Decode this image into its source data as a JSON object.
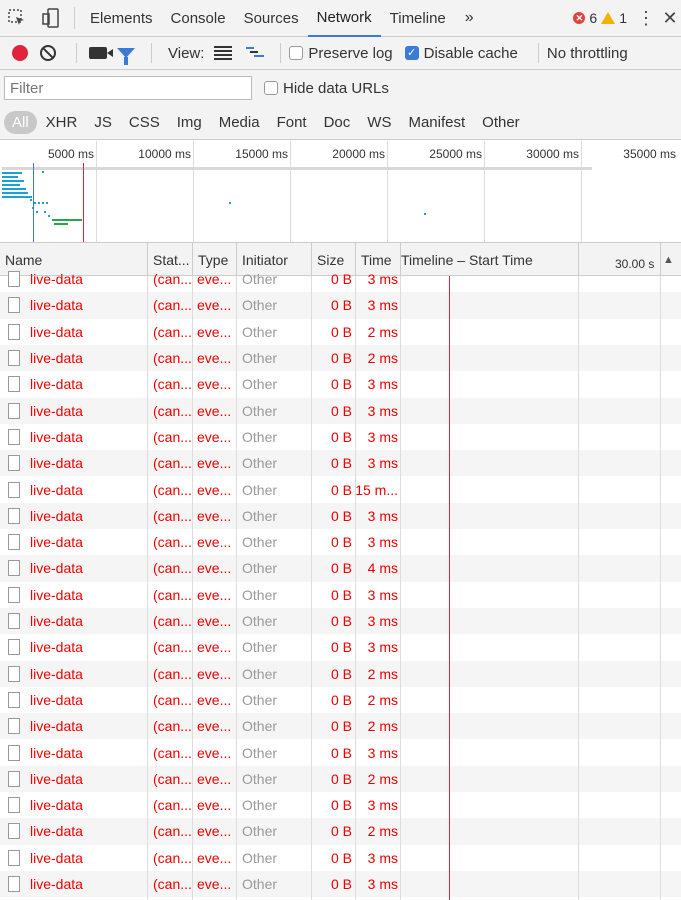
{
  "tabs": [
    "Elements",
    "Console",
    "Sources",
    "Network",
    "Timeline"
  ],
  "active_tab": "Network",
  "more_tabs": "»",
  "error_count": "6",
  "warning_count": "1",
  "toolbar": {
    "view_label": "View:",
    "preserve_log": "Preserve log",
    "disable_cache": "Disable cache",
    "throttling": "No throttling"
  },
  "filter": {
    "placeholder": "Filter",
    "hide_data_urls": "Hide data URLs"
  },
  "types": [
    "All",
    "XHR",
    "JS",
    "CSS",
    "Img",
    "Media",
    "Font",
    "Doc",
    "WS",
    "Manifest",
    "Other"
  ],
  "overview_ticks": [
    "5000 ms",
    "10000 ms",
    "15000 ms",
    "20000 ms",
    "25000 ms",
    "30000 ms",
    "35000 ms"
  ],
  "columns": {
    "name": "Name",
    "status": "Stat...",
    "type": "Type",
    "initiator": "Initiator",
    "size": "Size",
    "time": "Time",
    "timeline": "Timeline – Start Time",
    "timeline_scale": "30.00 s"
  },
  "rows": [
    {
      "name": "live-data",
      "status": "(can...",
      "type": "eve...",
      "initiator": "Other",
      "size": "0 B",
      "time": "3 ms"
    },
    {
      "name": "live-data",
      "status": "(can...",
      "type": "eve...",
      "initiator": "Other",
      "size": "0 B",
      "time": "3 ms"
    },
    {
      "name": "live-data",
      "status": "(can...",
      "type": "eve...",
      "initiator": "Other",
      "size": "0 B",
      "time": "2 ms"
    },
    {
      "name": "live-data",
      "status": "(can...",
      "type": "eve...",
      "initiator": "Other",
      "size": "0 B",
      "time": "2 ms"
    },
    {
      "name": "live-data",
      "status": "(can...",
      "type": "eve...",
      "initiator": "Other",
      "size": "0 B",
      "time": "3 ms"
    },
    {
      "name": "live-data",
      "status": "(can...",
      "type": "eve...",
      "initiator": "Other",
      "size": "0 B",
      "time": "3 ms"
    },
    {
      "name": "live-data",
      "status": "(can...",
      "type": "eve...",
      "initiator": "Other",
      "size": "0 B",
      "time": "3 ms"
    },
    {
      "name": "live-data",
      "status": "(can...",
      "type": "eve...",
      "initiator": "Other",
      "size": "0 B",
      "time": "3 ms"
    },
    {
      "name": "live-data",
      "status": "(can...",
      "type": "eve...",
      "initiator": "Other",
      "size": "0 B",
      "time": "15 m..."
    },
    {
      "name": "live-data",
      "status": "(can...",
      "type": "eve...",
      "initiator": "Other",
      "size": "0 B",
      "time": "3 ms"
    },
    {
      "name": "live-data",
      "status": "(can...",
      "type": "eve...",
      "initiator": "Other",
      "size": "0 B",
      "time": "3 ms"
    },
    {
      "name": "live-data",
      "status": "(can...",
      "type": "eve...",
      "initiator": "Other",
      "size": "0 B",
      "time": "4 ms"
    },
    {
      "name": "live-data",
      "status": "(can...",
      "type": "eve...",
      "initiator": "Other",
      "size": "0 B",
      "time": "3 ms"
    },
    {
      "name": "live-data",
      "status": "(can...",
      "type": "eve...",
      "initiator": "Other",
      "size": "0 B",
      "time": "3 ms"
    },
    {
      "name": "live-data",
      "status": "(can...",
      "type": "eve...",
      "initiator": "Other",
      "size": "0 B",
      "time": "3 ms"
    },
    {
      "name": "live-data",
      "status": "(can...",
      "type": "eve...",
      "initiator": "Other",
      "size": "0 B",
      "time": "2 ms"
    },
    {
      "name": "live-data",
      "status": "(can...",
      "type": "eve...",
      "initiator": "Other",
      "size": "0 B",
      "time": "2 ms"
    },
    {
      "name": "live-data",
      "status": "(can...",
      "type": "eve...",
      "initiator": "Other",
      "size": "0 B",
      "time": "2 ms"
    },
    {
      "name": "live-data",
      "status": "(can...",
      "type": "eve...",
      "initiator": "Other",
      "size": "0 B",
      "time": "3 ms"
    },
    {
      "name": "live-data",
      "status": "(can...",
      "type": "eve...",
      "initiator": "Other",
      "size": "0 B",
      "time": "2 ms"
    },
    {
      "name": "live-data",
      "status": "(can...",
      "type": "eve...",
      "initiator": "Other",
      "size": "0 B",
      "time": "3 ms"
    },
    {
      "name": "live-data",
      "status": "(can...",
      "type": "eve...",
      "initiator": "Other",
      "size": "0 B",
      "time": "2 ms"
    },
    {
      "name": "live-data",
      "status": "(can...",
      "type": "eve...",
      "initiator": "Other",
      "size": "0 B",
      "time": "3 ms"
    },
    {
      "name": "live-data",
      "status": "(can...",
      "type": "eve...",
      "initiator": "Other",
      "size": "0 B",
      "time": "3 ms"
    }
  ],
  "colors": {
    "accent": "#3b7bd8",
    "error": "#e00000",
    "record": "#e0243a"
  }
}
